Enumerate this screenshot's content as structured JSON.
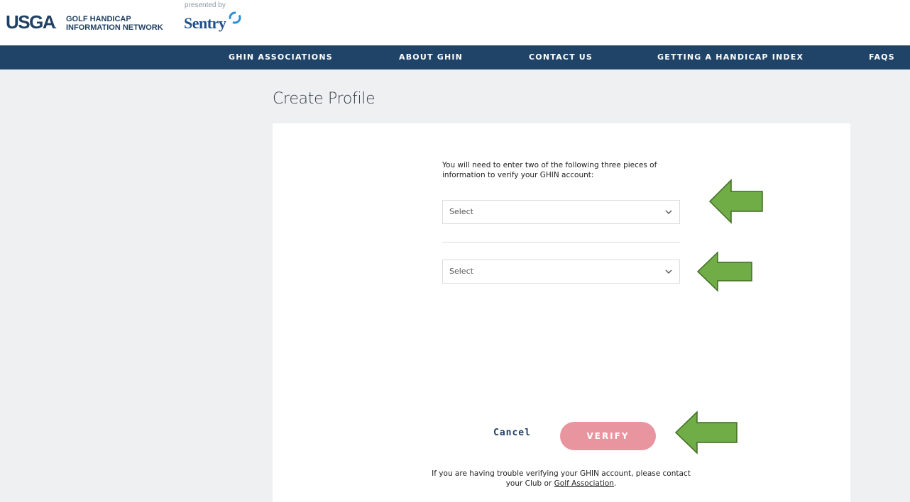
{
  "header": {
    "logo_text": "USGA",
    "logo_dot": ".",
    "network_line1": "GOLF HANDICAP",
    "network_line2": "INFORMATION NETWORK",
    "presented_by": "presented by",
    "sponsor": "Sentry"
  },
  "nav": {
    "items": [
      "GHIN ASSOCIATIONS",
      "ABOUT GHIN",
      "CONTACT US",
      "GETTING A HANDICAP INDEX",
      "FAQS"
    ]
  },
  "page": {
    "title": "Create Profile",
    "instructions": "You will need to enter two of the following three pieces of information to verify your GHIN account:",
    "select1": "Select",
    "select2": "Select",
    "cancel_label": "Cancel",
    "verify_label": "VERIFY",
    "help_text": "If you are having trouble verifying your GHIN account, please contact your Club or",
    "help_link": "Golf Association",
    "help_end": "."
  },
  "colors": {
    "nav_bg": "#1f4468",
    "page_bg": "#eff0f2",
    "verify_bg": "#e8959f",
    "arrow_fill": "#70ad47",
    "arrow_stroke": "#3e6b23"
  },
  "icons": {
    "chevron": "chevron-down-icon",
    "arrow": "left-arrow-annotation"
  }
}
